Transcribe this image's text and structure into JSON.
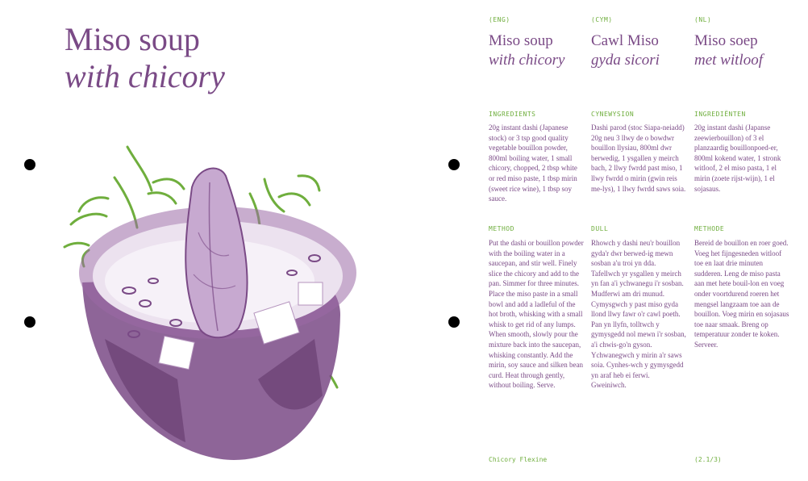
{
  "left_page": {
    "title_line1": "Miso soup",
    "title_line2": "with chicory"
  },
  "columns": [
    {
      "lang": "(ENG)",
      "title_line1": "Miso soup",
      "title_line2": "with chicory",
      "ingredients_label": "INGREDIENTS",
      "ingredients_text": "20g instant dashi (Japanese stock) or 3 tsp good quality vegetable bouillon powder, 800ml boiling water, 1 small chicory, chopped, 2 tbsp white or red miso paste, 1 tbsp mirin (sweet rice wine), 1 tbsp soy sauce.",
      "method_label": "METHOD",
      "method_text": "Put the dashi or bouillon powder with the boiling water in a saucepan, and stir well. Finely slice the chicory and add to the pan. Simmer for three minutes. Place the miso paste in a small bowl and add a ladleful of the hot broth, whisking with a small whisk to get rid of any lumps. When smooth, slowly pour the mixture back into the saucepan, whisking constantly. Add the mirin, soy sauce and silken bean curd. Heat through gently, without boiling. Serve."
    },
    {
      "lang": "(CYM)",
      "title_line1": "Cawl Miso",
      "title_line2": "gyda sicori",
      "ingredients_label": "CYNEWYSION",
      "ingredients_text": "Dashi parod (stoc Siapa-neiadd) 20g neu 3 llwy de o bowdwr bouillon llysiau, 800ml dwr berwedig, 1 ysgallen y meirch bach, 2 llwy fwrdd past miso, 1 llwy fwrdd o mirin (gwin reis me-lys), 1 llwy fwrdd saws soia.",
      "method_label": "DULL",
      "method_text": "Rhowch y dashi neu'r bouillon gyda'r dwr berwed-ig mewn sosban a'u troi yn dda. Tafellwch yr ysgallen y meirch yn fan a'i ychwanegu i'r sosban. Mudferwi am dri munud. Cymysgwch y past miso gyda llond llwy fawr o'r cawl poeth. Pan yn llyfn, tolltwch y gymysgedd nol mewn i'r sosban, a'i chwis-go'n gyson. Ychwanegwch y mirin a'r saws soia. Cynhes-wch y gymysgedd yn araf heb ei ferwi. Gweiniwch."
    },
    {
      "lang": "(NL)",
      "title_line1": "Miso soep",
      "title_line2": "met witloof",
      "ingredients_label": "INGREDIËNTEN",
      "ingredients_text": "20g instant dashi (Japanse zeewierbouillon) of 3 el planzaardig bouillonpoed-er, 800ml kokend water, 1 stronk witloof, 2 el miso pasta, 1 el mirin (zoete rijst-wijn), 1 el sojasaus.",
      "method_label": "METHODE",
      "method_text": "Bereid de bouillon en roer goed. Voeg het fijngesneden witloof toe en laat drie minuten sudderen. Leng de miso pasta aan met hete bouil-lon en voeg onder voortdurend roeren het mengsel langzaam toe aan de bouillon. Voeg mirin en sojasaus toe naar smaak. Breng op temperatuur zonder te koken. Serveer."
    }
  ],
  "footer": {
    "left": "Chicory Flexine",
    "right": "(2.1/3)"
  },
  "colors": {
    "purple": "#7a4a86",
    "green": "#6fae3d",
    "hole": "#000000"
  },
  "icons": {
    "illustration": "miso-soup-bowl-with-chicory"
  }
}
